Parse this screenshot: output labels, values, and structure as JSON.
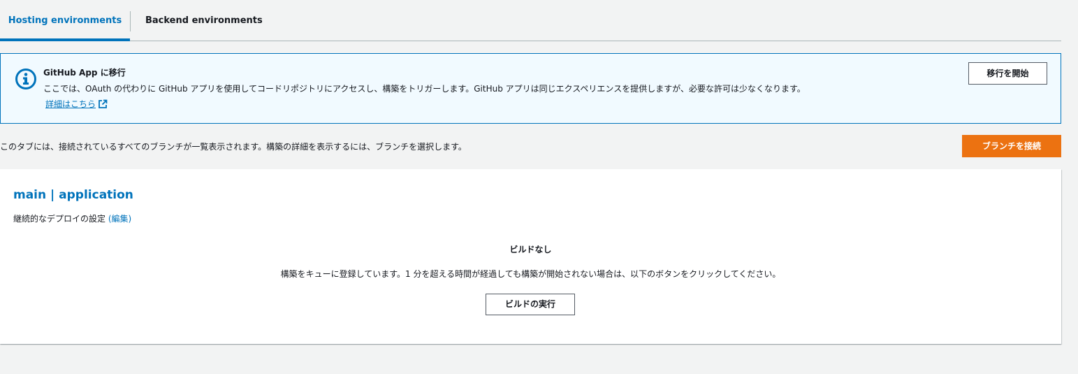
{
  "tabs": {
    "hosting": "Hosting environments",
    "backend": "Backend environments"
  },
  "flash": {
    "title": "GitHub App に移行",
    "body": "ここでは、OAuth の代わりに GitHub アプリを使用してコードリポジトリにアクセスし、構築をトリガーします。GitHub アプリは同じエクスペリエンスを提供しますが、必要な許可は少なくなります。",
    "link": "詳細はこちら",
    "button": "移行を開始",
    "icon": "info-circle-icon",
    "color": "#0073bb"
  },
  "description": "このタブには、接続されているすべてのブランチが一覧表示されます。構築の詳細を表示するには、ブランチを選択します。",
  "connect_button": "ブランチを接続",
  "accent_color": "#ec7211",
  "branch": {
    "title": "main | application",
    "cd_label": "継続的なデプロイの設定",
    "cd_edit_open": "(",
    "cd_edit": "編集",
    "cd_edit_close": ")",
    "empty_title": "ビルドなし",
    "empty_message": "構築をキューに登録しています。1 分を超える時間が経過しても構築が開始されない場合は、以下のボタンをクリックしてください。",
    "run_button": "ビルドの実行"
  }
}
